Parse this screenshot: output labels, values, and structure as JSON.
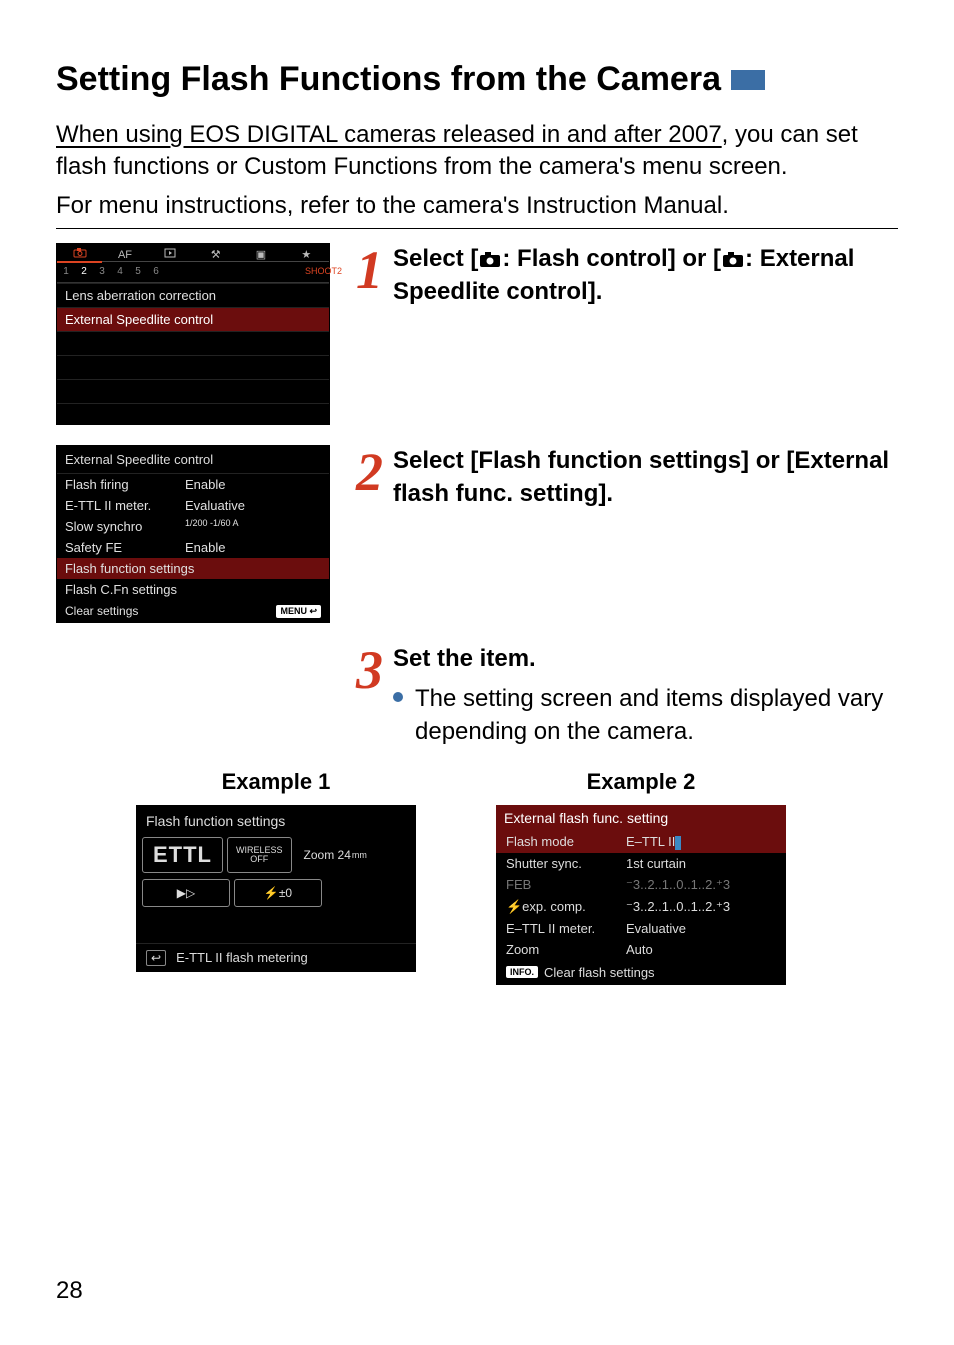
{
  "page_number": "28",
  "title": "Setting Flash Functions from the Camera",
  "intro_underlined": "When using EOS DIGITAL cameras released in and after 2007",
  "intro_rest": ", you can set flash functions or Custom Functions from the camera's menu screen.",
  "intro_line2": "For menu instructions, refer to the camera's Instruction Manual.",
  "steps": {
    "s1": {
      "num": "1",
      "text_a": "Select [",
      "text_b": ": Flash control] or [",
      "text_c": ": External Speedlite control]."
    },
    "s2": {
      "num": "2",
      "text": "Select [Flash function settings] or [External flash func. setting]."
    },
    "s3": {
      "num": "3",
      "heading": "Set the item.",
      "bullet": "The setting screen and items displayed vary depending on the camera."
    }
  },
  "lcd1": {
    "tab_icons": [
      "●",
      "AF",
      "▶",
      "⚒",
      "▣",
      "★"
    ],
    "subtabs": [
      "1",
      "2",
      "3",
      "4",
      "5",
      "6"
    ],
    "shoot_label": "SHOOT2",
    "items": [
      "Lens aberration correction",
      "External Speedlite control"
    ]
  },
  "lcd2": {
    "header": "External Speedlite control",
    "rows": [
      {
        "k": "Flash firing",
        "v": "Enable"
      },
      {
        "k": "E-TTL II meter.",
        "v": "Evaluative"
      },
      {
        "k": "Slow synchro",
        "v": "1/200 -1/60 A"
      },
      {
        "k": "Safety FE",
        "v": "Enable"
      }
    ],
    "sel": "Flash function settings",
    "after": "Flash C.Fn settings",
    "clear": "Clear settings",
    "menu": "MENU ↩"
  },
  "ex1": {
    "label": "Example 1",
    "header": "Flash function settings",
    "ettl": "ETTL",
    "wireless_top": "WIRELESS",
    "wireless_bot": "OFF",
    "zoom": "Zoom  24",
    "zoom_mm": "mm",
    "row2a": "▶▷",
    "row2b": "⚡±0",
    "footer": "E-TTL II flash metering",
    "back": "↩"
  },
  "ex2": {
    "label": "Example 2",
    "header": "External flash func. setting",
    "rows": [
      {
        "k": "Flash mode",
        "v": "E–TTL II",
        "sel": true
      },
      {
        "k": "Shutter sync.",
        "v": "1st curtain"
      },
      {
        "k": "FEB",
        "v": "⁻3..2..1..0..1..2.⁺3",
        "dim": true
      },
      {
        "k": "⚡exp. comp.",
        "v": "⁻3..2..1..0..1..2.⁺3"
      },
      {
        "k": "E–TTL II meter.",
        "v": "Evaluative"
      },
      {
        "k": "Zoom",
        "v": "Auto"
      }
    ],
    "info": "INFO.",
    "footer": "Clear flash settings"
  }
}
